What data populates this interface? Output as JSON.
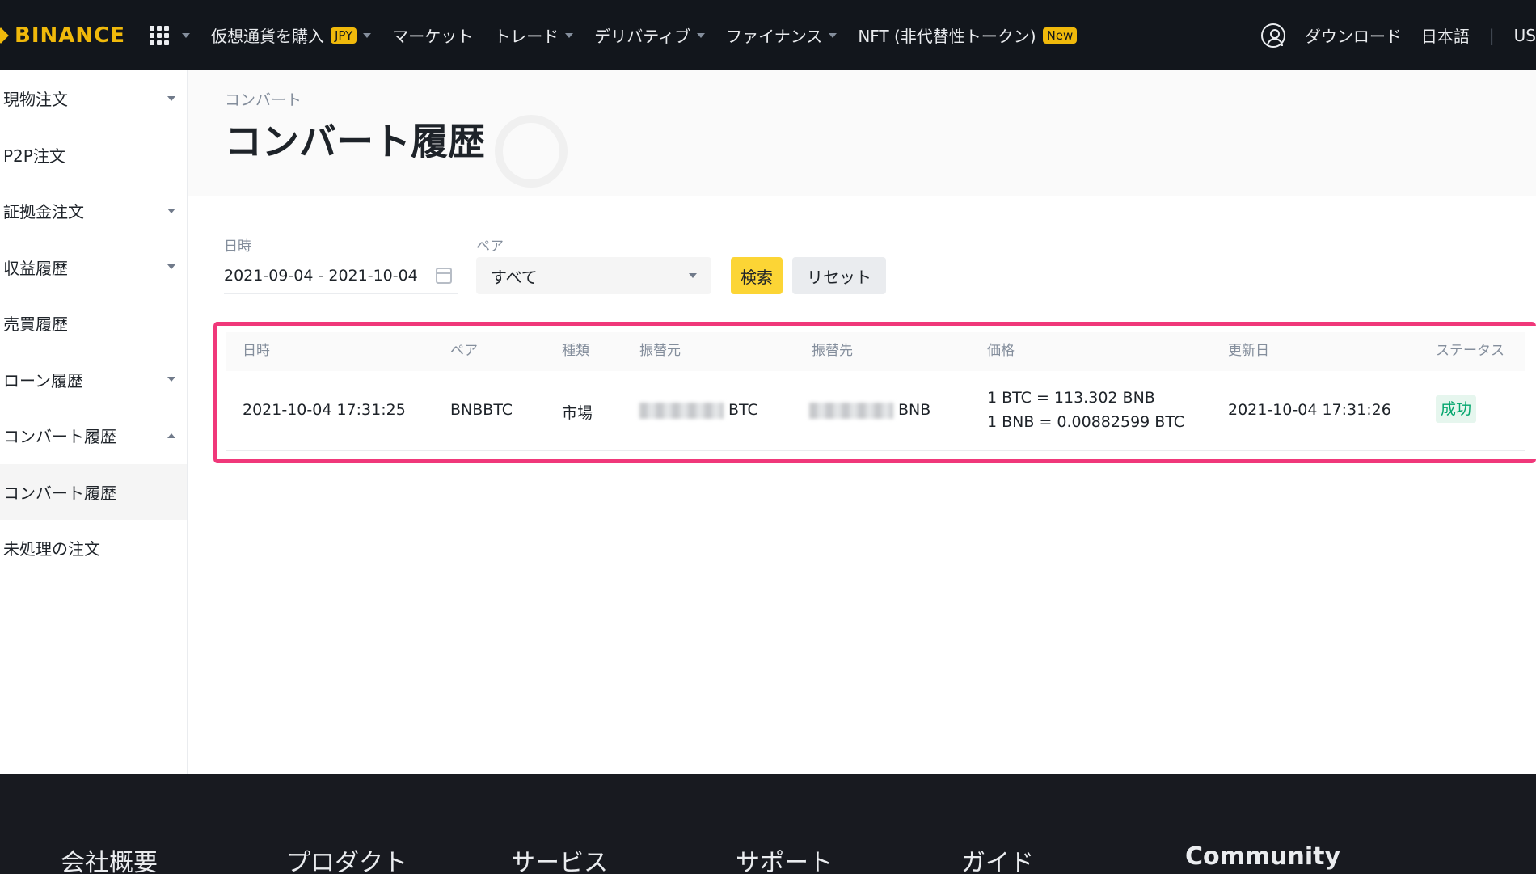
{
  "nav": {
    "brand": "BINANCE",
    "items": [
      {
        "label": "仮想通貨を購入",
        "tag": "JPY"
      },
      {
        "label": "マーケット"
      },
      {
        "label": "トレード"
      },
      {
        "label": "デリバティブ"
      },
      {
        "label": "ファイナンス"
      },
      {
        "label": "NFT (非代替性トークン)",
        "tag": "New"
      }
    ],
    "download": "ダウンロード",
    "language": "日本語",
    "sep": "|",
    "currency": "US"
  },
  "sidebar": {
    "items": [
      {
        "label": "現物注文"
      },
      {
        "label": "P2P注文"
      },
      {
        "label": "証拠金注文"
      },
      {
        "label": "収益履歴"
      },
      {
        "label": "売買履歴"
      },
      {
        "label": "ローン履歴"
      },
      {
        "label": "コンバート履歴"
      },
      {
        "label": "コンバート履歴"
      },
      {
        "label": "未処理の注文"
      }
    ]
  },
  "header": {
    "breadcrumb": "コンバート",
    "title": "コンバート履歴"
  },
  "filters": {
    "date_label": "日時",
    "date_value": "2021-09-04 - 2021-10-04",
    "pair_label": "ペア",
    "pair_value": "すべて",
    "search_label": "検索",
    "reset_label": "リセット"
  },
  "table": {
    "headers": [
      "日時",
      "ペア",
      "種類",
      "振替元",
      "振替先",
      "価格",
      "更新日",
      "ステータス"
    ],
    "row": {
      "time": "2021-10-04 17:31:25",
      "pair": "BNBBTC",
      "type": "市場",
      "from_unit": "BTC",
      "to_unit": "BNB",
      "price_line1": "1 BTC = 113.302 BNB",
      "price_line2": "1 BNB = 0.00882599 BTC",
      "updated": "2021-10-04 17:31:26",
      "status": "成功"
    }
  },
  "footer": {
    "columns": [
      "会社概要",
      "プロダクト",
      "サービス",
      "サポート",
      "ガイド",
      "Community"
    ]
  },
  "colors": {
    "brand": "#f0b90b",
    "highlight": "#f0387a",
    "success": "#03a66d"
  }
}
